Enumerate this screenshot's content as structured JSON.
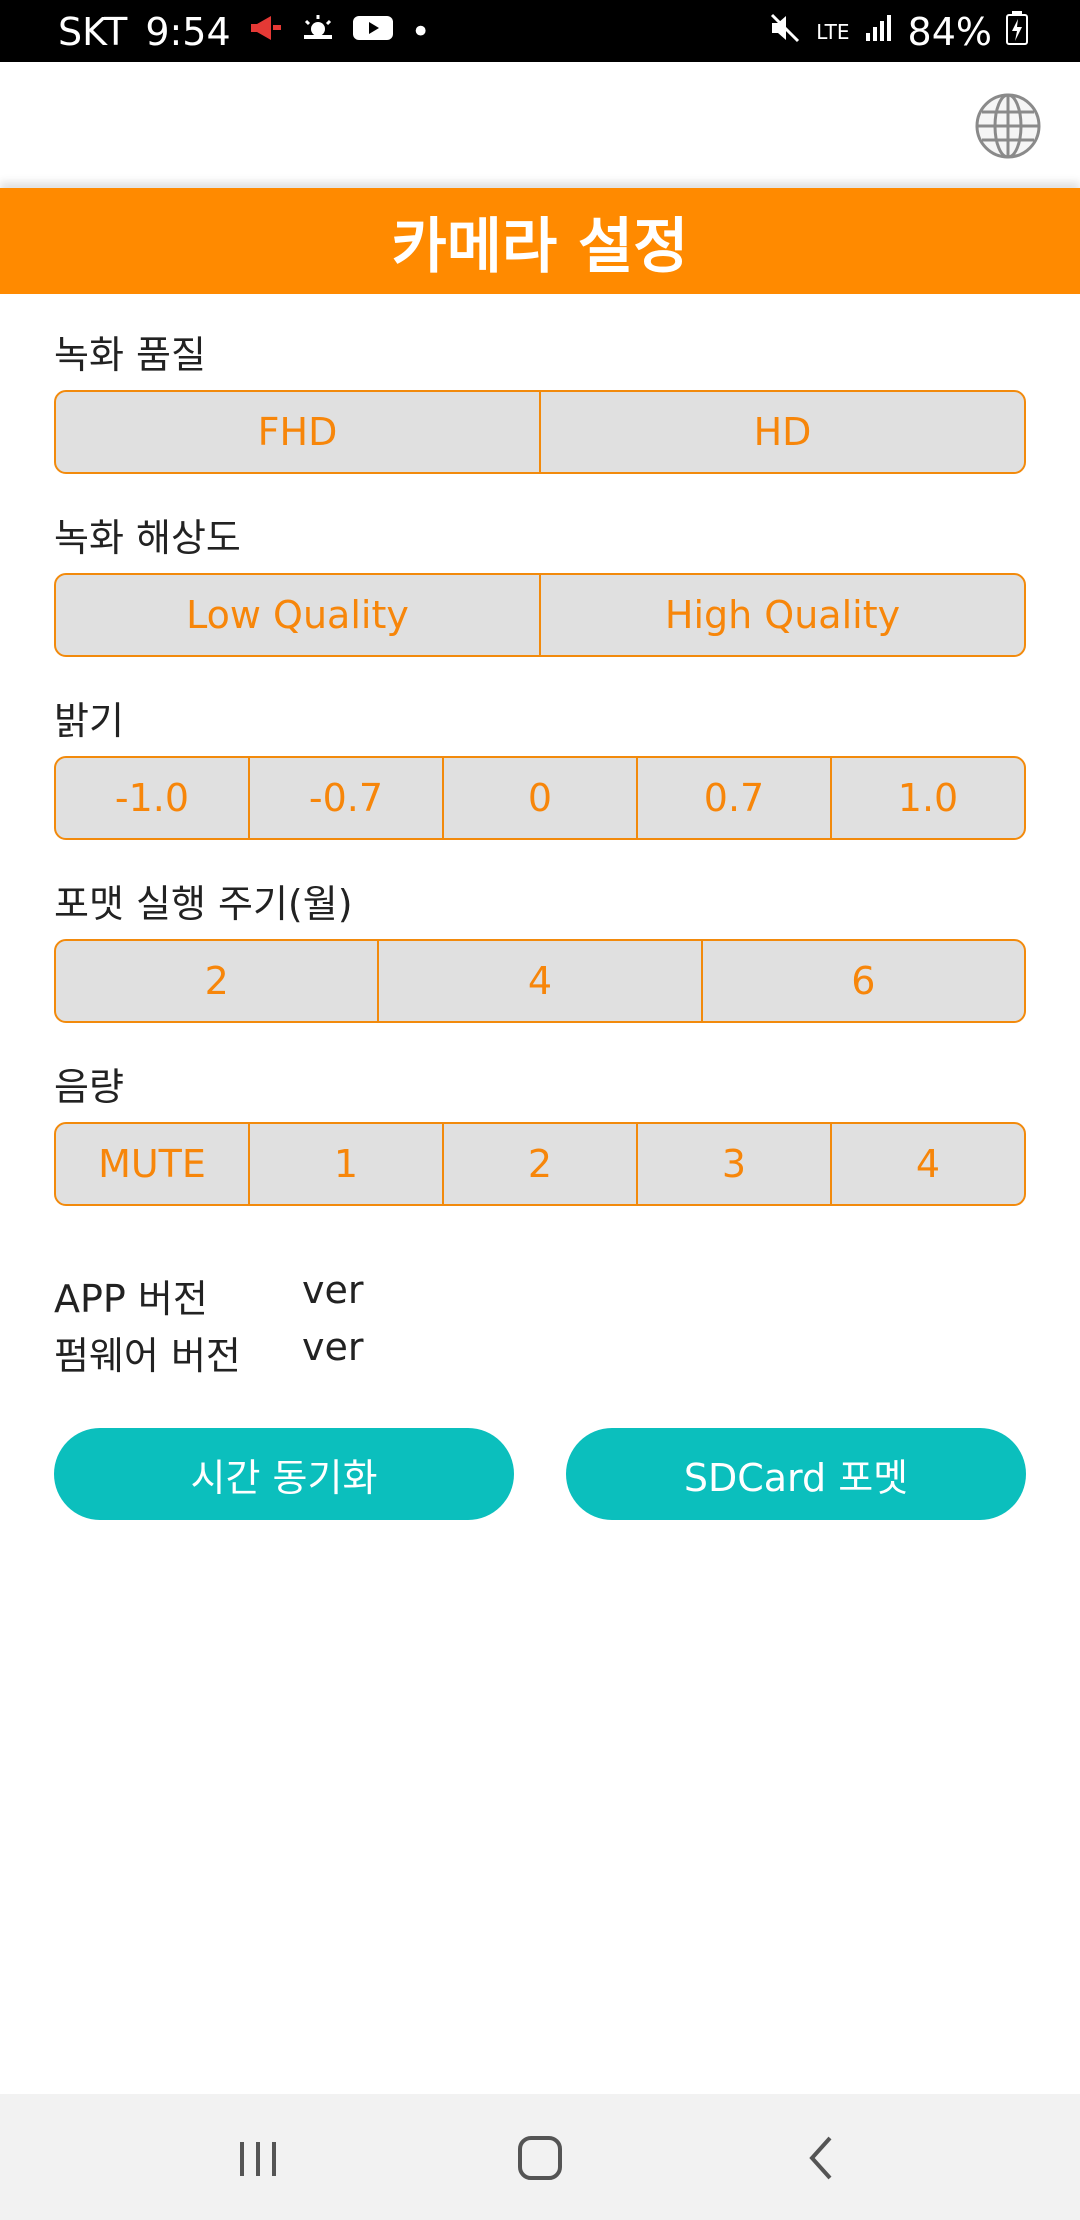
{
  "status_bar": {
    "carrier": "SKT",
    "time": "9:54",
    "network": "LTE",
    "battery": "84%"
  },
  "header": {
    "title": "카메라 설정",
    "globe_icon": "globe-icon"
  },
  "sections": {
    "record_quality": {
      "label": "녹화 품질",
      "options": [
        "FHD",
        "HD"
      ]
    },
    "record_resolution": {
      "label": "녹화 해상도",
      "options": [
        "Low Quality",
        "High Quality"
      ]
    },
    "brightness": {
      "label": "밝기",
      "options": [
        "-1.0",
        "-0.7",
        "0",
        "0.7",
        "1.0"
      ]
    },
    "format_cycle": {
      "label": "포맷 실행 주기(월)",
      "options": [
        "2",
        "4",
        "6"
      ]
    },
    "volume": {
      "label": "음량",
      "options": [
        "MUTE",
        "1",
        "2",
        "3",
        "4"
      ]
    }
  },
  "info": {
    "app_version_label": "APP 버전",
    "app_version_value": "ver",
    "firmware_version_label": "펌웨어 버전",
    "firmware_version_value": "ver"
  },
  "buttons": {
    "time_sync": "시간 동기화",
    "sd_format": "SDCard 포멧"
  },
  "colors": {
    "accent_orange": "#ff8a00",
    "option_text": "#f7860a",
    "option_bg": "#e0e0e0",
    "button_teal": "#0bbfbd"
  },
  "nav_bar": {
    "icons": [
      "recent-apps-icon",
      "home-icon",
      "back-icon"
    ]
  }
}
